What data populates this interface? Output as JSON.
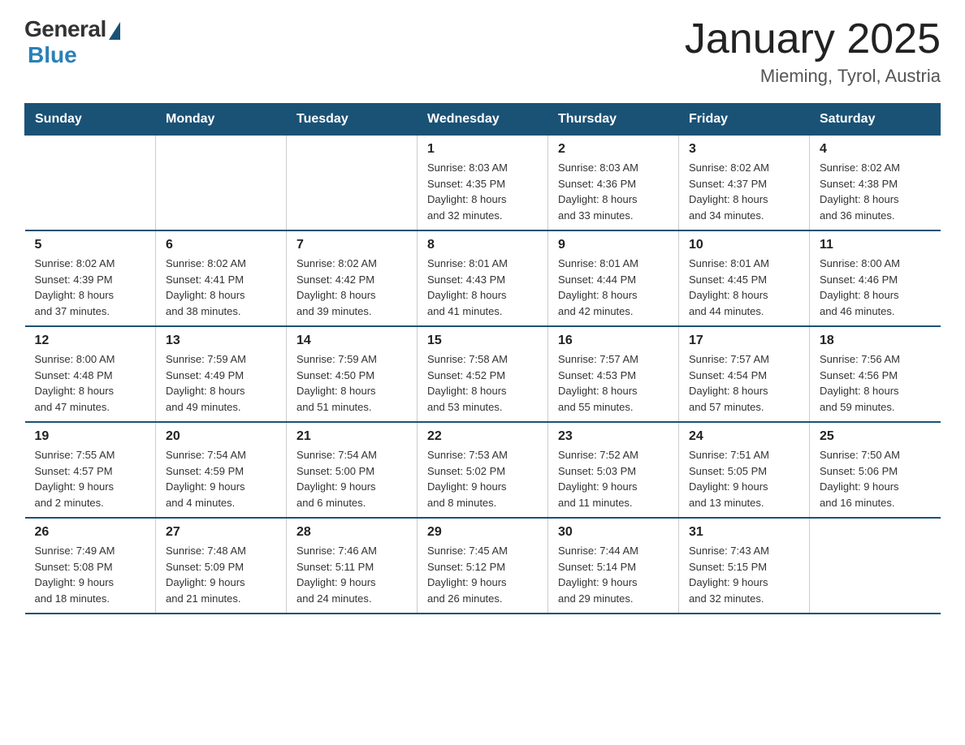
{
  "logo": {
    "general": "General",
    "blue": "Blue"
  },
  "title": "January 2025",
  "subtitle": "Mieming, Tyrol, Austria",
  "weekdays": [
    "Sunday",
    "Monday",
    "Tuesday",
    "Wednesday",
    "Thursday",
    "Friday",
    "Saturday"
  ],
  "weeks": [
    [
      {
        "day": "",
        "info": ""
      },
      {
        "day": "",
        "info": ""
      },
      {
        "day": "",
        "info": ""
      },
      {
        "day": "1",
        "info": "Sunrise: 8:03 AM\nSunset: 4:35 PM\nDaylight: 8 hours\nand 32 minutes."
      },
      {
        "day": "2",
        "info": "Sunrise: 8:03 AM\nSunset: 4:36 PM\nDaylight: 8 hours\nand 33 minutes."
      },
      {
        "day": "3",
        "info": "Sunrise: 8:02 AM\nSunset: 4:37 PM\nDaylight: 8 hours\nand 34 minutes."
      },
      {
        "day": "4",
        "info": "Sunrise: 8:02 AM\nSunset: 4:38 PM\nDaylight: 8 hours\nand 36 minutes."
      }
    ],
    [
      {
        "day": "5",
        "info": "Sunrise: 8:02 AM\nSunset: 4:39 PM\nDaylight: 8 hours\nand 37 minutes."
      },
      {
        "day": "6",
        "info": "Sunrise: 8:02 AM\nSunset: 4:41 PM\nDaylight: 8 hours\nand 38 minutes."
      },
      {
        "day": "7",
        "info": "Sunrise: 8:02 AM\nSunset: 4:42 PM\nDaylight: 8 hours\nand 39 minutes."
      },
      {
        "day": "8",
        "info": "Sunrise: 8:01 AM\nSunset: 4:43 PM\nDaylight: 8 hours\nand 41 minutes."
      },
      {
        "day": "9",
        "info": "Sunrise: 8:01 AM\nSunset: 4:44 PM\nDaylight: 8 hours\nand 42 minutes."
      },
      {
        "day": "10",
        "info": "Sunrise: 8:01 AM\nSunset: 4:45 PM\nDaylight: 8 hours\nand 44 minutes."
      },
      {
        "day": "11",
        "info": "Sunrise: 8:00 AM\nSunset: 4:46 PM\nDaylight: 8 hours\nand 46 minutes."
      }
    ],
    [
      {
        "day": "12",
        "info": "Sunrise: 8:00 AM\nSunset: 4:48 PM\nDaylight: 8 hours\nand 47 minutes."
      },
      {
        "day": "13",
        "info": "Sunrise: 7:59 AM\nSunset: 4:49 PM\nDaylight: 8 hours\nand 49 minutes."
      },
      {
        "day": "14",
        "info": "Sunrise: 7:59 AM\nSunset: 4:50 PM\nDaylight: 8 hours\nand 51 minutes."
      },
      {
        "day": "15",
        "info": "Sunrise: 7:58 AM\nSunset: 4:52 PM\nDaylight: 8 hours\nand 53 minutes."
      },
      {
        "day": "16",
        "info": "Sunrise: 7:57 AM\nSunset: 4:53 PM\nDaylight: 8 hours\nand 55 minutes."
      },
      {
        "day": "17",
        "info": "Sunrise: 7:57 AM\nSunset: 4:54 PM\nDaylight: 8 hours\nand 57 minutes."
      },
      {
        "day": "18",
        "info": "Sunrise: 7:56 AM\nSunset: 4:56 PM\nDaylight: 8 hours\nand 59 minutes."
      }
    ],
    [
      {
        "day": "19",
        "info": "Sunrise: 7:55 AM\nSunset: 4:57 PM\nDaylight: 9 hours\nand 2 minutes."
      },
      {
        "day": "20",
        "info": "Sunrise: 7:54 AM\nSunset: 4:59 PM\nDaylight: 9 hours\nand 4 minutes."
      },
      {
        "day": "21",
        "info": "Sunrise: 7:54 AM\nSunset: 5:00 PM\nDaylight: 9 hours\nand 6 minutes."
      },
      {
        "day": "22",
        "info": "Sunrise: 7:53 AM\nSunset: 5:02 PM\nDaylight: 9 hours\nand 8 minutes."
      },
      {
        "day": "23",
        "info": "Sunrise: 7:52 AM\nSunset: 5:03 PM\nDaylight: 9 hours\nand 11 minutes."
      },
      {
        "day": "24",
        "info": "Sunrise: 7:51 AM\nSunset: 5:05 PM\nDaylight: 9 hours\nand 13 minutes."
      },
      {
        "day": "25",
        "info": "Sunrise: 7:50 AM\nSunset: 5:06 PM\nDaylight: 9 hours\nand 16 minutes."
      }
    ],
    [
      {
        "day": "26",
        "info": "Sunrise: 7:49 AM\nSunset: 5:08 PM\nDaylight: 9 hours\nand 18 minutes."
      },
      {
        "day": "27",
        "info": "Sunrise: 7:48 AM\nSunset: 5:09 PM\nDaylight: 9 hours\nand 21 minutes."
      },
      {
        "day": "28",
        "info": "Sunrise: 7:46 AM\nSunset: 5:11 PM\nDaylight: 9 hours\nand 24 minutes."
      },
      {
        "day": "29",
        "info": "Sunrise: 7:45 AM\nSunset: 5:12 PM\nDaylight: 9 hours\nand 26 minutes."
      },
      {
        "day": "30",
        "info": "Sunrise: 7:44 AM\nSunset: 5:14 PM\nDaylight: 9 hours\nand 29 minutes."
      },
      {
        "day": "31",
        "info": "Sunrise: 7:43 AM\nSunset: 5:15 PM\nDaylight: 9 hours\nand 32 minutes."
      },
      {
        "day": "",
        "info": ""
      }
    ]
  ]
}
